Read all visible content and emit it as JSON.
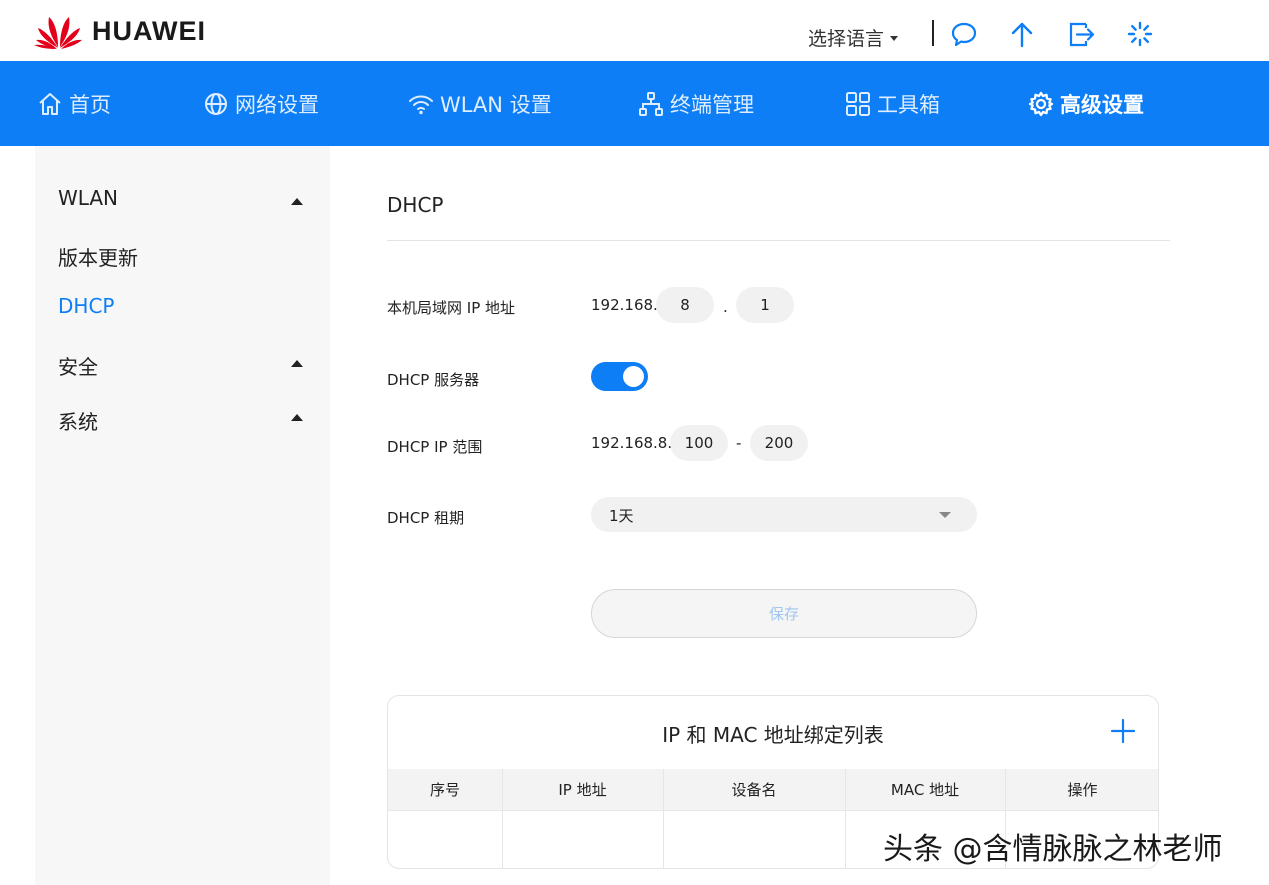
{
  "header": {
    "brand": "HUAWEI",
    "language_label": "选择语言",
    "icons": [
      "chat-icon",
      "upload-arrow-icon",
      "logout-icon",
      "loading-icon"
    ]
  },
  "nav": {
    "items": [
      {
        "label": "首页",
        "icon": "home-icon"
      },
      {
        "label": "网络设置",
        "icon": "globe-icon"
      },
      {
        "label": "WLAN 设置",
        "icon": "wifi-icon"
      },
      {
        "label": "终端管理",
        "icon": "devices-icon"
      },
      {
        "label": "工具箱",
        "icon": "grid-icon"
      },
      {
        "label": "高级设置",
        "icon": "gear-icon",
        "active": true
      }
    ]
  },
  "sidebar": {
    "items": [
      {
        "label": "WLAN",
        "expandable": true
      },
      {
        "label": "版本更新"
      },
      {
        "label": "DHCP",
        "active": true
      },
      {
        "label": "安全",
        "expandable": true
      },
      {
        "label": "系统",
        "expandable": true
      }
    ]
  },
  "main": {
    "title": "DHCP",
    "lan_ip_label": "本机局域网 IP 地址",
    "lan_ip_prefix": "192.168.",
    "lan_ip_octet3": "8",
    "lan_ip_dot": ".",
    "lan_ip_octet4": "1",
    "dhcp_server_label": "DHCP 服务器",
    "dhcp_server_enabled": true,
    "range_label": "DHCP IP 范围",
    "range_prefix": "192.168.8.",
    "range_start": "100",
    "range_dash": "-",
    "range_end": "200",
    "lease_label": "DHCP 租期",
    "lease_value": "1天",
    "save_label": "保存"
  },
  "binding_table": {
    "title": "IP 和 MAC 地址绑定列表",
    "columns": [
      "序号",
      "IP 地址",
      "设备名",
      "MAC 地址",
      "操作"
    ],
    "rows": []
  },
  "watermark": "头条 @含情脉脉之林老师",
  "colors": {
    "accent": "#0d7ef5",
    "brand_red": "#e3001b"
  }
}
